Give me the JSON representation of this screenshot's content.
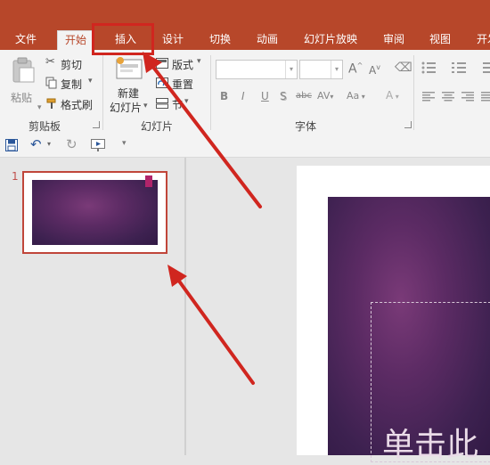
{
  "tabs": [
    {
      "label": "文件"
    },
    {
      "label": "开始"
    },
    {
      "label": "插入"
    },
    {
      "label": "设计"
    },
    {
      "label": "切换"
    },
    {
      "label": "动画"
    },
    {
      "label": "幻灯片放映"
    },
    {
      "label": "审阅"
    },
    {
      "label": "视图"
    },
    {
      "label": "开发"
    }
  ],
  "clipboard": {
    "paste": "粘贴",
    "cut": "剪切",
    "copy": "复制",
    "format_painter": "格式刷",
    "group_label": "剪贴板"
  },
  "slides_group": {
    "new_slide_line1": "新建",
    "new_slide_line2": "幻灯片",
    "layout": "版式",
    "reset": "重置",
    "section": "节",
    "group_label": "幻灯片"
  },
  "font_group": {
    "font_name": "",
    "font_size": "",
    "bold": "B",
    "italic": "I",
    "underline": "U",
    "shadow": "S",
    "strike": "abc",
    "spacing": "AV",
    "case": "Aa",
    "grow": "A",
    "shrink": "A",
    "group_label": "字体"
  },
  "thumbnail": {
    "number": "1"
  },
  "slide": {
    "title_fragment": "单击此"
  },
  "colors": {
    "accent": "#b7472a",
    "highlight_red": "#d0261f",
    "slide_purple": "#4a2458",
    "tag_pink": "#b0246a"
  }
}
